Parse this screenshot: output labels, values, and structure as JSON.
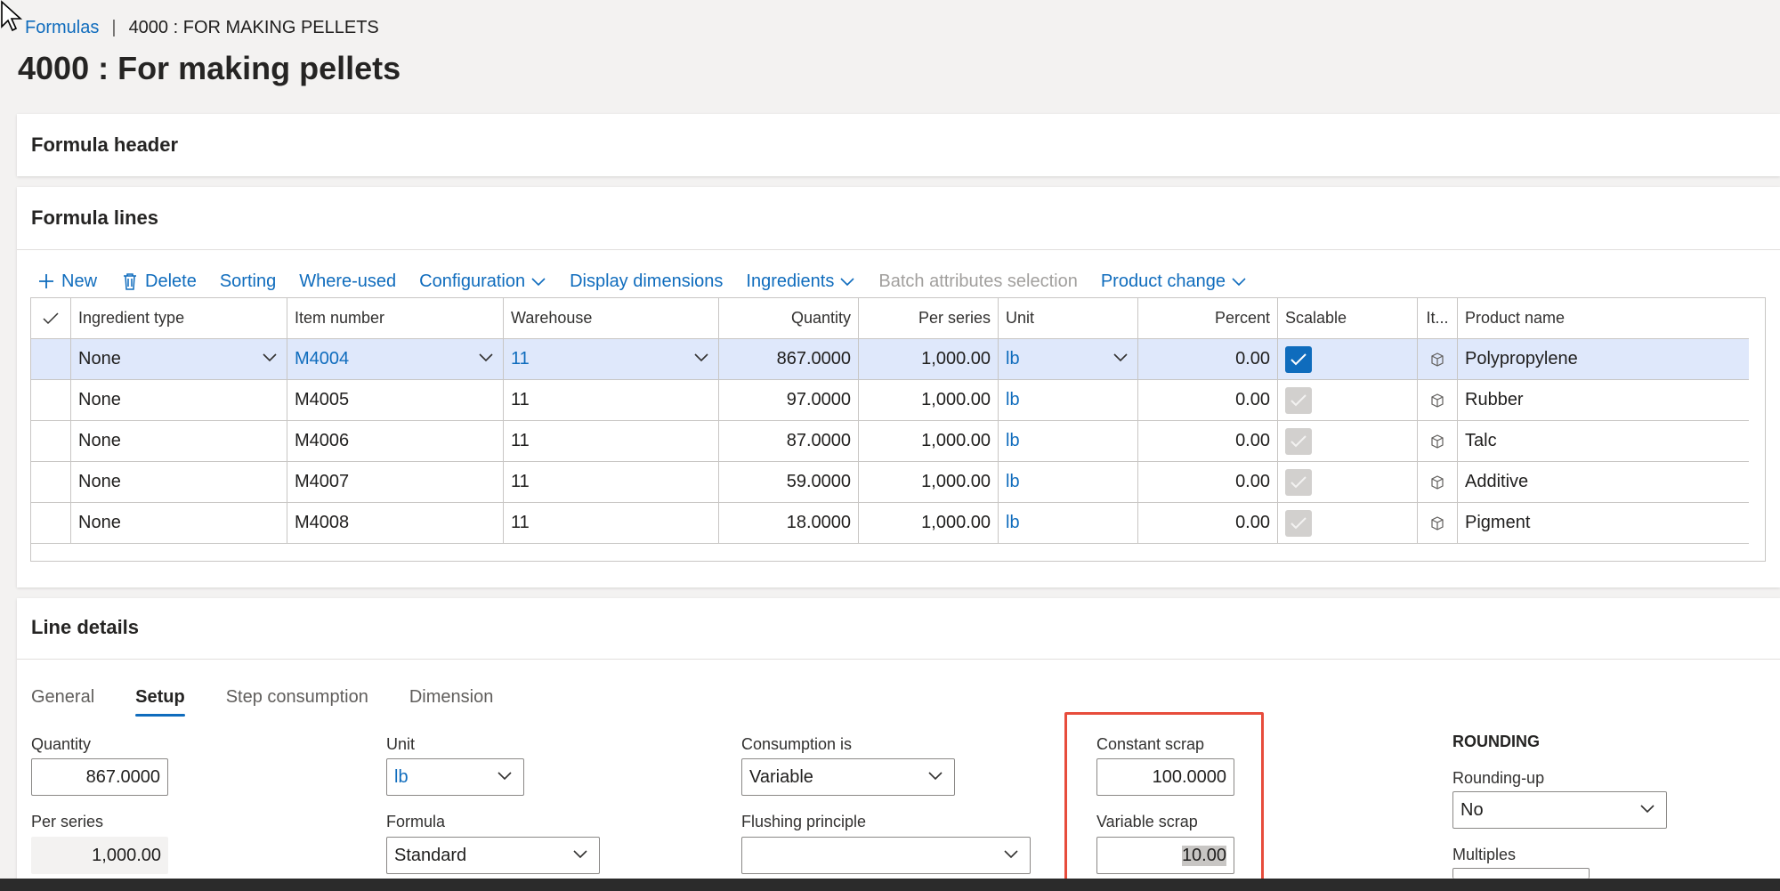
{
  "breadcrumb": {
    "link": "Formulas",
    "separator": "|",
    "current": "4000 : FOR MAKING PELLETS"
  },
  "page_title": "4000 : For making pellets",
  "formula_header": {
    "title": "Formula header"
  },
  "formula_lines": {
    "title": "Formula lines",
    "toolbar": {
      "new": "New",
      "delete": "Delete",
      "sorting": "Sorting",
      "where_used": "Where-used",
      "configuration": "Configuration",
      "display_dimensions": "Display dimensions",
      "ingredients": "Ingredients",
      "batch_attributes": "Batch attributes selection",
      "product_change": "Product change"
    },
    "columns": {
      "ingredient_type": "Ingredient type",
      "item_number": "Item number",
      "warehouse": "Warehouse",
      "quantity": "Quantity",
      "per_series": "Per series",
      "unit": "Unit",
      "percent": "Percent",
      "scalable": "Scalable",
      "item_icon": "It...",
      "product_name": "Product name"
    },
    "rows": [
      {
        "ingredient_type": "None",
        "item_number": "M4004",
        "warehouse": "11",
        "quantity": "867.0000",
        "per_series": "1,000.00",
        "unit": "lb",
        "percent": "0.00",
        "product_name": "Polypropylene"
      },
      {
        "ingredient_type": "None",
        "item_number": "M4005",
        "warehouse": "11",
        "quantity": "97.0000",
        "per_series": "1,000.00",
        "unit": "lb",
        "percent": "0.00",
        "product_name": "Rubber"
      },
      {
        "ingredient_type": "None",
        "item_number": "M4006",
        "warehouse": "11",
        "quantity": "87.0000",
        "per_series": "1,000.00",
        "unit": "lb",
        "percent": "0.00",
        "product_name": "Talc"
      },
      {
        "ingredient_type": "None",
        "item_number": "M4007",
        "warehouse": "11",
        "quantity": "59.0000",
        "per_series": "1,000.00",
        "unit": "lb",
        "percent": "0.00",
        "product_name": "Additive"
      },
      {
        "ingredient_type": "None",
        "item_number": "M4008",
        "warehouse": "11",
        "quantity": "18.0000",
        "per_series": "1,000.00",
        "unit": "lb",
        "percent": "0.00",
        "product_name": "Pigment"
      }
    ]
  },
  "line_details": {
    "title": "Line details",
    "tabs": [
      "General",
      "Setup",
      "Step consumption",
      "Dimension"
    ],
    "active_tab": "Setup",
    "fields": {
      "quantity_label": "Quantity",
      "quantity_value": "867.0000",
      "per_series_label": "Per series",
      "per_series_value": "1,000.00",
      "unit_label": "Unit",
      "unit_value": "lb",
      "formula_label": "Formula",
      "formula_value": "Standard",
      "consumption_label": "Consumption is",
      "consumption_value": "Variable",
      "flushing_label": "Flushing principle",
      "flushing_value": "",
      "constant_scrap_label": "Constant scrap",
      "constant_scrap_value": "100.0000",
      "variable_scrap_label": "Variable scrap",
      "variable_scrap_value": "10.00",
      "rounding_title": "ROUNDING",
      "rounding_up_label": "Rounding-up",
      "rounding_up_value": "No",
      "multiples_label": "Multiples"
    }
  },
  "colors": {
    "accent": "#0f6cbd",
    "highlight_box": "#e74c3c",
    "selected_row": "#dfe8fb"
  }
}
